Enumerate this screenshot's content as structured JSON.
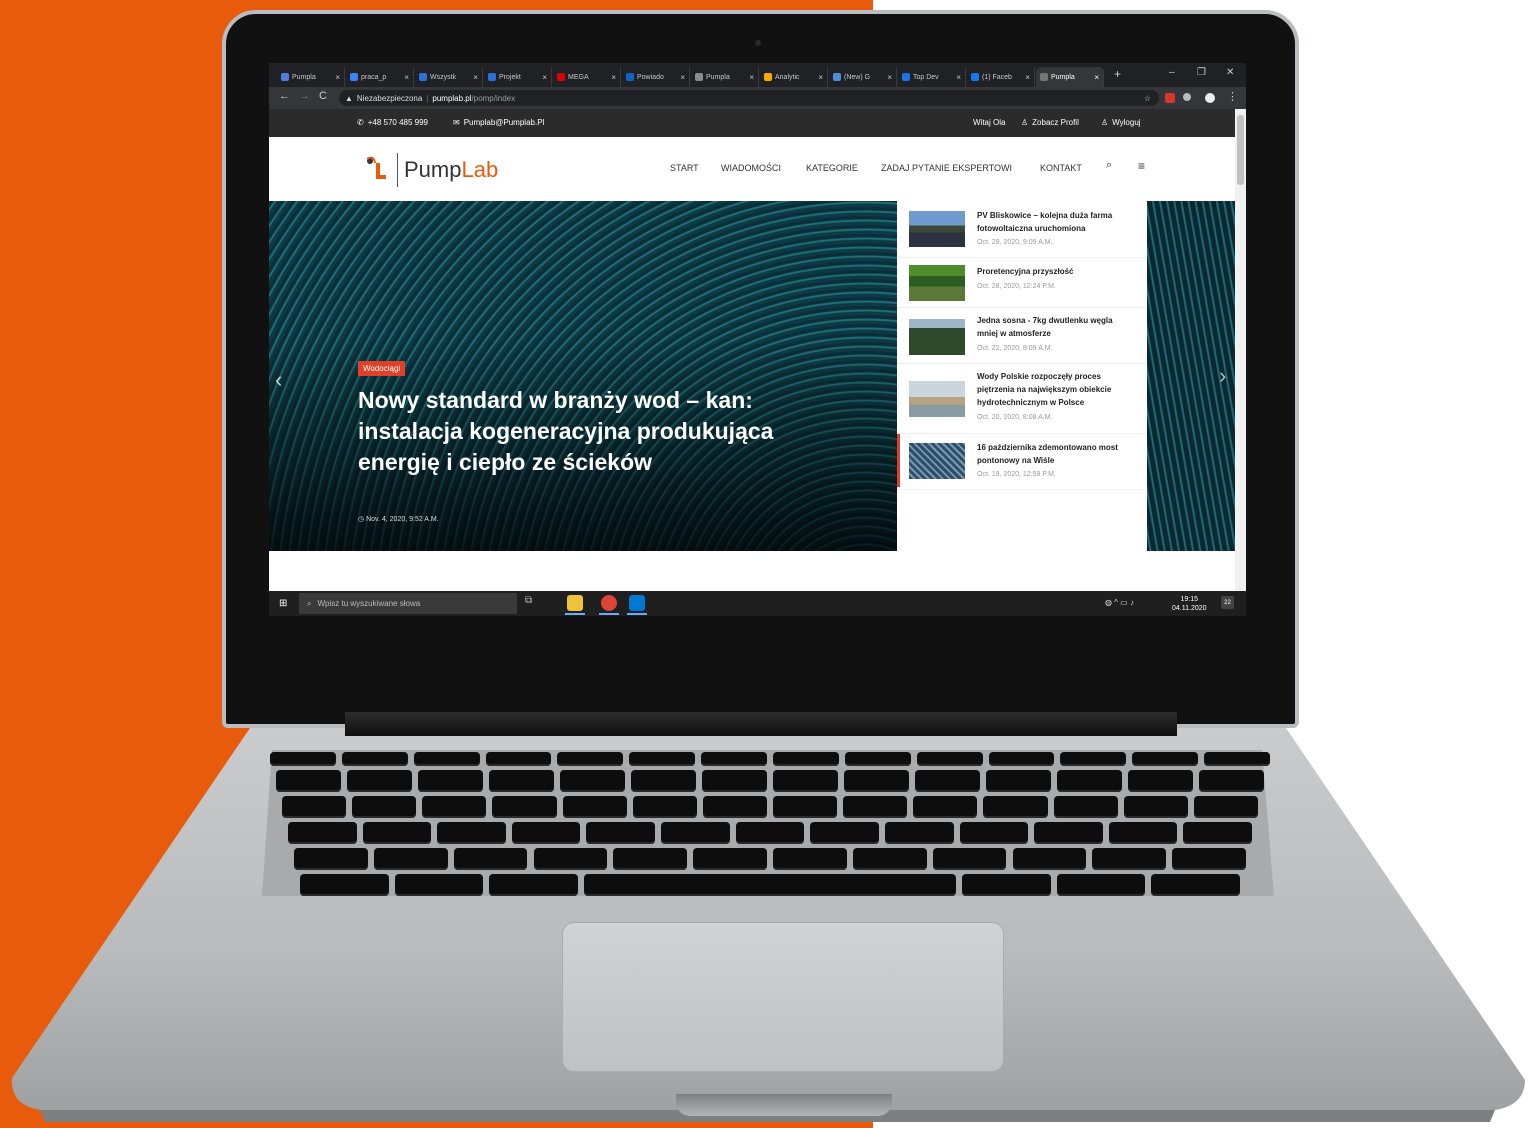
{
  "browser": {
    "tabs": [
      {
        "label": "Pumpla",
        "fav": "#4f7bd9",
        "active": false
      },
      {
        "label": "praca_p",
        "fav": "#3b82f6",
        "active": false
      },
      {
        "label": "Wszystk",
        "fav": "#2f6fdb",
        "active": false
      },
      {
        "label": "Projekt",
        "fav": "#2f6fdb",
        "active": false
      },
      {
        "label": "MEGA",
        "fav": "#d90007",
        "active": false
      },
      {
        "label": "Powiado",
        "fav": "#0a66c2",
        "active": false
      },
      {
        "label": "Pumpla",
        "fav": "#8a8a8a",
        "active": false
      },
      {
        "label": "Analytic",
        "fav": "#f9ab00",
        "active": false
      },
      {
        "label": "(New) G",
        "fav": "#4f8bd9",
        "active": false
      },
      {
        "label": "Top Dev",
        "fav": "#1a73e8",
        "active": false
      },
      {
        "label": "(1) Faceb",
        "fav": "#1877f2",
        "active": false
      },
      {
        "label": "Pumpla",
        "fav": "#777777",
        "active": true
      }
    ],
    "new_tab": "+",
    "window_controls": {
      "minimize": "–",
      "maximize": "❐",
      "close": "✕"
    },
    "nav": {
      "back": "←",
      "forward": "→",
      "reload": "C"
    },
    "address": {
      "security": "Niezabezpieczona",
      "host": "pumplab.pl",
      "path": "/pomp/index"
    }
  },
  "topbar": {
    "phone": "+48 570 485 999",
    "email": "Pumplab@Pumplab.Pl",
    "greeting": "Witaj Ola",
    "profile": "Zobacz Profil",
    "logout": "Wyloguj"
  },
  "header": {
    "logo_a": "Pump",
    "logo_b": "Lab",
    "nav": [
      "START",
      "WIADOMOŚCI",
      "KATEGORIE",
      "ZADAJ PYTANIE EKSPERTOWI",
      "KONTAKT"
    ],
    "search_icon": "search-icon",
    "menu_icon": "hamburger-icon"
  },
  "hero": {
    "tag": "Wodociągi",
    "title": "Nowy standard w branży wod – kan: instalacja kogeneracyjna produkująca energię i ciepło ze ścieków",
    "date": "Nov. 4, 2020, 9:52 A.M."
  },
  "sidebar": {
    "items": [
      {
        "title": "PV Bliskowice – kolejna duża farma fotowoltaiczna uruchomiona",
        "date": "Oct. 29, 2020, 9:09 A.M."
      },
      {
        "title": "Proretencyjna przyszłość",
        "date": "Oct. 28, 2020, 12:24 P.M."
      },
      {
        "title": "Jedna sosna - 7kg dwutlenku węgla mniej w atmosferze",
        "date": "Oct. 22, 2020, 8:09 A.M."
      },
      {
        "title": "Wody Polskie rozpoczęły proces piętrzenia na największym obiekcie hydrotechnicznym w Polsce",
        "date": "Oct. 20, 2020, 8:08 A.M."
      },
      {
        "title": "16 października zdemontowano most pontonowy na Wiśle",
        "date": "Oct. 19, 2020, 12:59 P.M."
      }
    ]
  },
  "taskbar": {
    "search_placeholder": "Wpisz tu wyszukiwane słowa",
    "time": "19:15",
    "date": "04.11.2020",
    "notif": "22"
  },
  "colors": {
    "brand": "#e85a0c",
    "accent": "#e0402a"
  }
}
